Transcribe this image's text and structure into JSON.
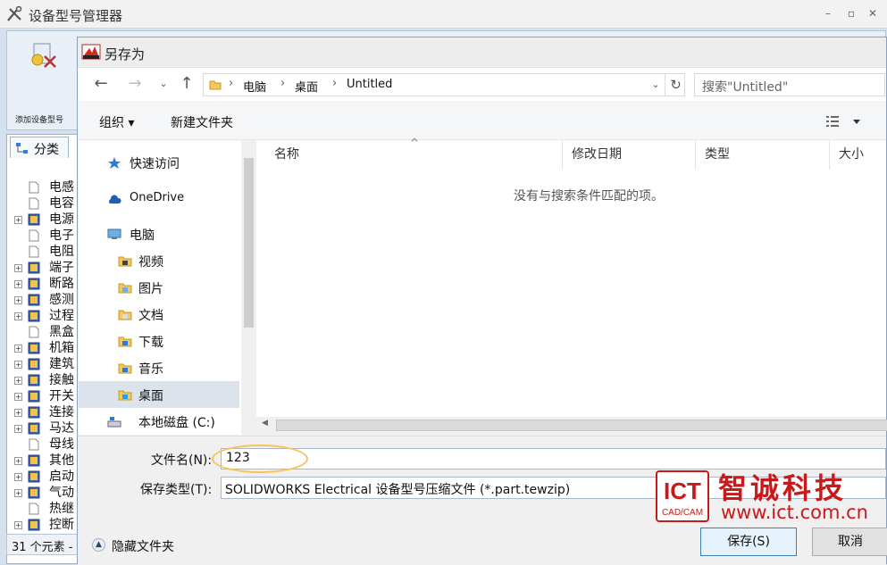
{
  "app": {
    "title": "设备型号管理器",
    "ribbon": {
      "add_model_label": "添加设备型号"
    },
    "left_panel": {
      "tab_label": "分类",
      "tree": [
        {
          "label": "电感",
          "expandable": false
        },
        {
          "label": "电容",
          "expandable": false
        },
        {
          "label": "电源",
          "expandable": true
        },
        {
          "label": "电子",
          "expandable": false
        },
        {
          "label": "电阻",
          "expandable": false
        },
        {
          "label": "端子",
          "expandable": true
        },
        {
          "label": "断路",
          "expandable": true
        },
        {
          "label": "感测",
          "expandable": true
        },
        {
          "label": "过程",
          "expandable": true
        },
        {
          "label": "黑盒",
          "expandable": false
        },
        {
          "label": "机箱",
          "expandable": true
        },
        {
          "label": "建筑",
          "expandable": true
        },
        {
          "label": "接触",
          "expandable": true
        },
        {
          "label": "开关",
          "expandable": true
        },
        {
          "label": "连接",
          "expandable": true
        },
        {
          "label": "马达",
          "expandable": true
        },
        {
          "label": "母线",
          "expandable": false
        },
        {
          "label": "其他",
          "expandable": true
        },
        {
          "label": "启动",
          "expandable": true
        },
        {
          "label": "气动",
          "expandable": true
        },
        {
          "label": "热继",
          "expandable": false
        },
        {
          "label": "控断",
          "expandable": true
        }
      ]
    },
    "status_text": "31 个元素 -"
  },
  "dialog": {
    "title": "另存为",
    "breadcrumb": [
      "电脑",
      "桌面",
      "Untitled"
    ],
    "search_placeholder": "搜索\"Untitled\"",
    "toolbar": {
      "organize": "组织 ▾",
      "new_folder": "新建文件夹"
    },
    "nav_items": [
      {
        "label": "快速访问",
        "icon": "star-icon"
      },
      {
        "label": "OneDrive",
        "icon": "cloud-icon"
      },
      {
        "label": "电脑",
        "icon": "computer-icon"
      },
      {
        "label": "视频",
        "icon": "video-folder-icon"
      },
      {
        "label": "图片",
        "icon": "pictures-folder-icon"
      },
      {
        "label": "文档",
        "icon": "documents-folder-icon"
      },
      {
        "label": "下载",
        "icon": "downloads-folder-icon"
      },
      {
        "label": "音乐",
        "icon": "music-folder-icon"
      },
      {
        "label": "桌面",
        "icon": "desktop-folder-icon"
      },
      {
        "label": "本地磁盘 (C:)",
        "icon": "drive-icon"
      }
    ],
    "selected_nav": "桌面",
    "columns": [
      "名称",
      "修改日期",
      "类型",
      "大小"
    ],
    "empty_message": "没有与搜索条件匹配的项。",
    "file_name_label": "文件名(N):",
    "file_name_value": "123",
    "file_type_label": "保存类型(T):",
    "file_type_value": "SOLIDWORKS Electrical 设备型号压缩文件 (*.part.tewzip)",
    "hide_folders_label": "隐藏文件夹",
    "save_label": "保存(S)",
    "cancel_label": "取消"
  },
  "watermark": {
    "logo_text": "ICT",
    "logo_sub": "CAD/CAM",
    "brand": "智诚科技",
    "url": "www.ict.com.cn"
  },
  "colors": {
    "accent": "#3c7fb1",
    "watermark": "#c81a1a",
    "highlight": "#f5c45b"
  }
}
